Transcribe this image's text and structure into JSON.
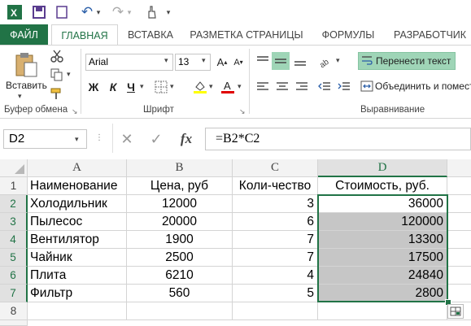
{
  "quick_access": {
    "app_icon": "excel-icon",
    "undo_label": "↶",
    "redo_label": "↷"
  },
  "tabs": [
    "ФАЙЛ",
    "ГЛАВНАЯ",
    "ВСТАВКА",
    "РАЗМЕТКА СТРАНИЦЫ",
    "ФОРМУЛЫ",
    "РАЗРАБОТЧИК"
  ],
  "ribbon": {
    "paste_label": "Вставить",
    "clipboard_group": "Буфер обмена",
    "font_name": "Arial",
    "font_size": "13",
    "font_group": "Шрифт",
    "bold": "Ж",
    "italic": "К",
    "underline": "Ч",
    "wrap_text": "Перенести текст",
    "merge_center": "Объединить и помест",
    "alignment_group": "Выравнивание"
  },
  "formula_bar": {
    "name_box": "D2",
    "cancel": "✕",
    "enter": "✓",
    "fx": "fx",
    "formula": "=B2*C2"
  },
  "colors": {
    "accent": "#217346",
    "selection_fill": "#c6c6c6",
    "header_fill": "#f3f3f3"
  },
  "sheet": {
    "columns": [
      "A",
      "B",
      "C",
      "D"
    ],
    "rows": [
      "1",
      "2",
      "3",
      "4",
      "5",
      "6",
      "7",
      "8"
    ],
    "header_row": [
      "Наименование",
      "Цена, руб",
      "Коли-чество",
      "Стоимость, руб."
    ],
    "data": [
      [
        "Холодильник",
        "12000",
        "3",
        "36000"
      ],
      [
        "Пылесос",
        "20000",
        "6",
        "120000"
      ],
      [
        "Вентилятор",
        "1900",
        "7",
        "13300"
      ],
      [
        "Чайник",
        "2500",
        "7",
        "17500"
      ],
      [
        "Плита",
        "6210",
        "4",
        "24840"
      ],
      [
        "Фильтр",
        "560",
        "5",
        "2800"
      ]
    ]
  }
}
